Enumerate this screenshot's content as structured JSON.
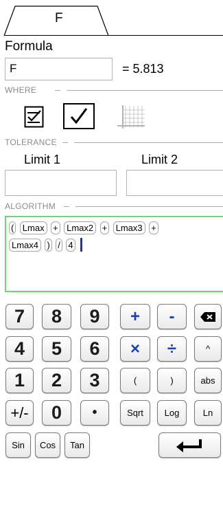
{
  "tab": {
    "label": "F"
  },
  "formula": {
    "title": "Formula",
    "input_value": "F",
    "result_text": "= 5.813"
  },
  "groups": {
    "where": "WHERE",
    "tolerance": "TOLERANCE",
    "algorithm": "ALGORITHM"
  },
  "where_icons": [
    "checklist-icon",
    "checkmark-box-icon",
    "grid-icon"
  ],
  "tolerance": {
    "limit1_label": "Limit 1",
    "limit2_label": "Limit 2",
    "limit1_value": "",
    "limit2_value": ""
  },
  "algorithm": {
    "tokens": [
      "(",
      "Lmax",
      "+",
      "Lmax2",
      "+",
      "Lmax3",
      "+",
      "Lmax4",
      ")",
      "/",
      "4"
    ]
  },
  "keypad": {
    "row1": [
      "7",
      "8",
      "9",
      "+",
      "-",
      "backspace-icon"
    ],
    "row2": [
      "4",
      "5",
      "6",
      "×",
      "÷",
      "^"
    ],
    "row3": [
      "1",
      "2",
      "3",
      "(",
      ")",
      "abs"
    ],
    "row4": [
      "+/-",
      "0",
      "•",
      "Sqrt",
      "Log",
      "Ln"
    ],
    "row5": [
      "Sin",
      "Cos",
      "Tan",
      "enter-icon"
    ]
  },
  "colors": {
    "accent_green": "#6fd36f",
    "operator_blue": "#1d40b0",
    "caret_blue": "#1a2fd6"
  }
}
